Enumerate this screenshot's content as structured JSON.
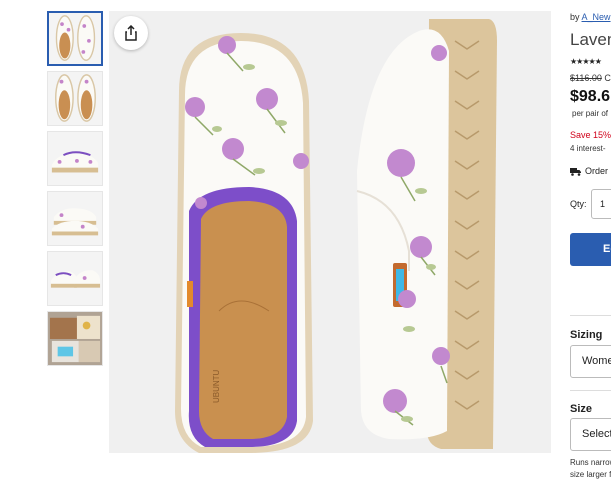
{
  "thumbnails": [
    {
      "alt": "top view pair"
    },
    {
      "alt": "top view single"
    },
    {
      "alt": "side view"
    },
    {
      "alt": "side view pair"
    },
    {
      "alt": "angled pair"
    },
    {
      "alt": "lifestyle box"
    }
  ],
  "main_image": {
    "share_icon": "share-icon"
  },
  "product": {
    "by_prefix": "by ",
    "by_link": "A_New",
    "title": "Laven",
    "stars": "★★★★★",
    "old_price": "$116.00",
    "old_price_suffix": " Co",
    "price": "$98.6",
    "per_pair": "per pair of",
    "save": "Save 15%",
    "interest": "4 interest-",
    "order": "Order",
    "qty_label": "Qty:",
    "qty_value": "1",
    "cta": "Ed"
  },
  "sizing": {
    "label": "Sizing",
    "selected": "Wome"
  },
  "size": {
    "label": "Size",
    "selected": "Select",
    "note_line1": "Runs narrow",
    "note_line2": "size larger f"
  },
  "colors": {
    "accent": "#2a5db0",
    "sale": "#d0021b"
  }
}
